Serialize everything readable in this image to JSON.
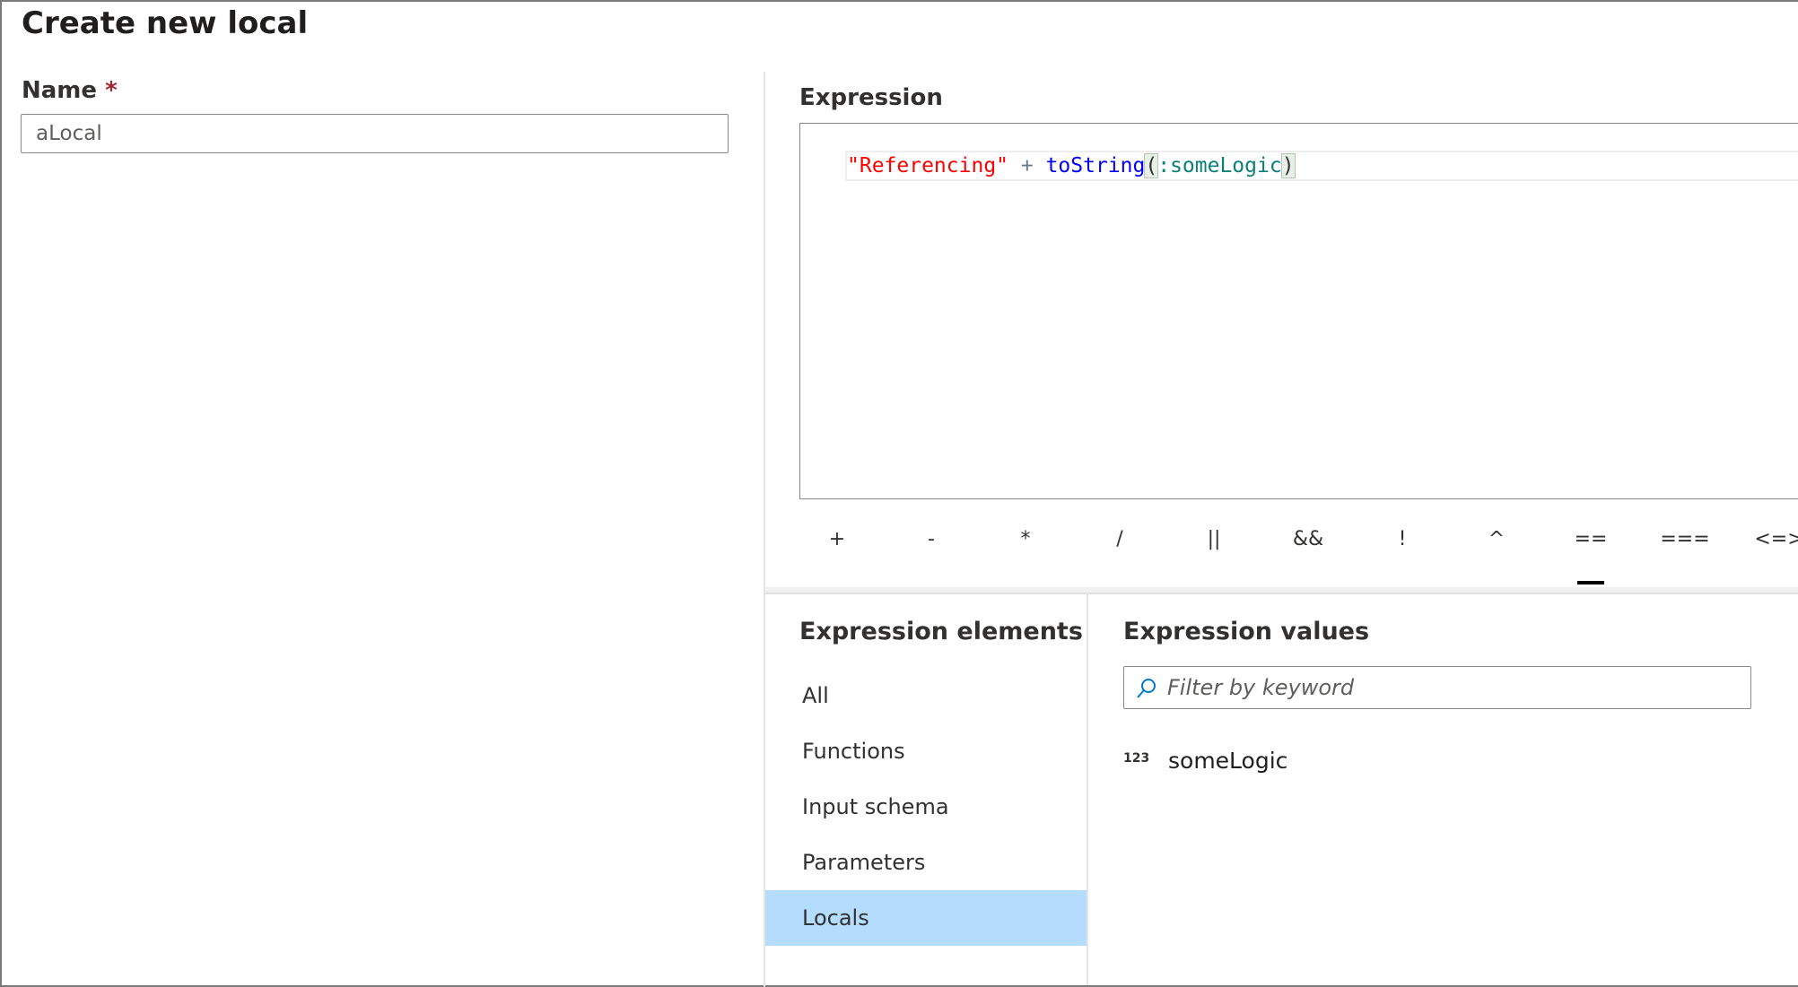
{
  "dialog": {
    "title": "Create new local"
  },
  "name_field": {
    "label": "Name",
    "required_marker": "*",
    "value": "aLocal"
  },
  "expression": {
    "label": "Expression",
    "code_tokens": [
      {
        "text": "\"Referencing\"",
        "kind": "string"
      },
      {
        "text": " + ",
        "kind": "operator"
      },
      {
        "text": "toString",
        "kind": "function"
      },
      {
        "text": "(",
        "kind": "bracket"
      },
      {
        "text": ":someLogic",
        "kind": "reference"
      },
      {
        "text": ")",
        "kind": "bracket"
      }
    ],
    "operators": [
      "+",
      "-",
      "*",
      "/",
      "||",
      "&&",
      "!",
      "^",
      "==",
      "===",
      "<=>"
    ],
    "selected_operator": "=="
  },
  "elements": {
    "title": "Expression elements",
    "items": [
      "All",
      "Functions",
      "Input schema",
      "Parameters",
      "Locals"
    ],
    "selected": "Locals"
  },
  "values": {
    "title": "Expression values",
    "filter_placeholder": "Filter by keyword",
    "items": [
      {
        "icon": "123",
        "icon_name": "number-type-icon",
        "label": "someLogic"
      }
    ]
  },
  "colors": {
    "selected_bg": "#b3dcfd",
    "string": "#ff0000",
    "function": "#0000ff",
    "reference": "#098178",
    "required": "#a4262c"
  }
}
